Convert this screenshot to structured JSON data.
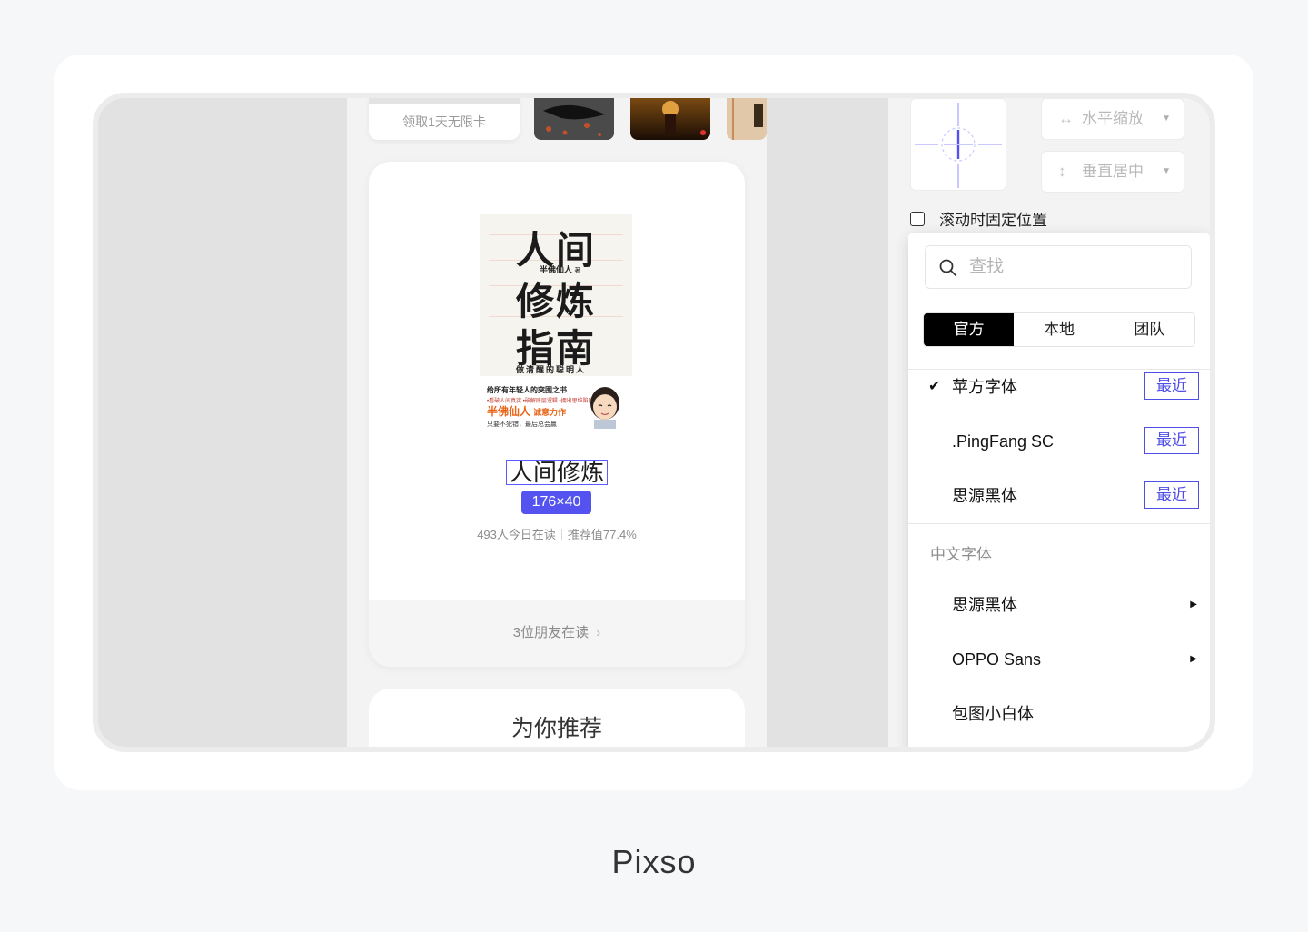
{
  "phone": {
    "vip_card_label": "领取1天无限卡",
    "book": {
      "cover_title_1": "人间",
      "cover_title_2": "修炼",
      "cover_title_3": "指南",
      "cover_author": "半佛仙人",
      "cover_author_suffix": "著",
      "cover_subtitle": "做清醒的聪明人",
      "cover_tagline": "给所有年轻人的突围之书",
      "cover_bullets": "•看破人间真实 •破解底层逻辑 •拥出思维陷阱",
      "cover_author_big": "半佛仙人",
      "cover_author_big_suffix": "诚意力作",
      "cover_slogan": "只要不犯错，最后总会赢",
      "title": "人间修炼",
      "size_badge": "176×40",
      "reading_today": "493人今日在读",
      "recommend_value": "推荐值77.4%",
      "friends_reading": "3位朋友在读",
      "friends_chevron": "›"
    },
    "recommend_title": "为你推荐"
  },
  "panel": {
    "scale_horizontal": "水平缩放",
    "scale_horizontal_icon": "↔",
    "align_vertical": "垂直居中",
    "align_vertical_icon": "↕",
    "caret": "▼",
    "fix_on_scroll": "滚动时固定位置",
    "font_picker": {
      "search_placeholder": "查找",
      "tabs": [
        {
          "label": "官方",
          "active": true
        },
        {
          "label": "本地",
          "active": false
        },
        {
          "label": "团队",
          "active": false
        }
      ],
      "recent_fonts": [
        {
          "name": "苹方字体",
          "checked": true,
          "check_mark": "✔",
          "tag": "最近"
        },
        {
          "name": ".PingFang SC",
          "checked": false,
          "tag": "最近"
        },
        {
          "name": "思源黑体",
          "checked": false,
          "tag": "最近"
        }
      ],
      "section_title": "中文字体",
      "chinese_fonts": [
        {
          "name": "思源黑体",
          "submenu": "▶"
        },
        {
          "name": "OPPO Sans",
          "submenu": "▶"
        },
        {
          "name": "包图小白体",
          "submenu": ""
        }
      ]
    }
  },
  "brand": "Pixso",
  "colors": {
    "accent": "#5553f0",
    "tag_border": "#4f4fe8",
    "guide": "#c9c9ff"
  }
}
